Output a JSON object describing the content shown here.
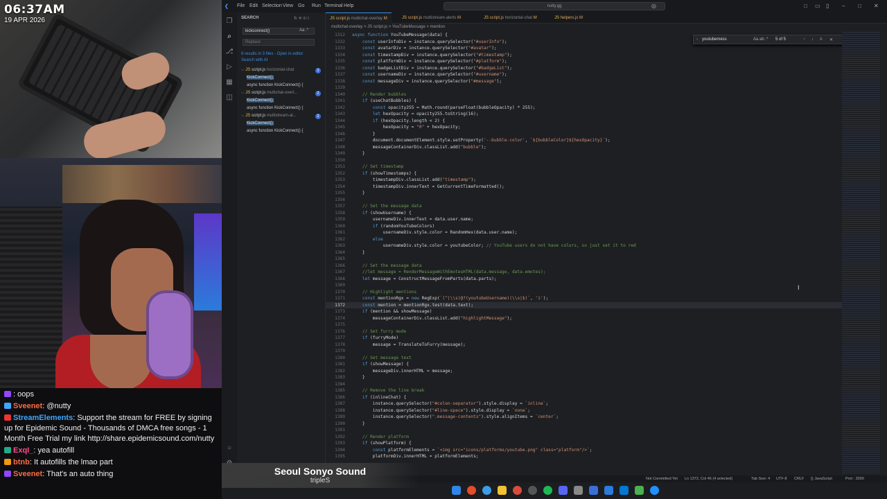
{
  "clock": {
    "time": "06:37AM",
    "date": "19 APR 2026"
  },
  "chat": {
    "messages": [
      {
        "user": "",
        "text": ": oops",
        "color": "#b0b0b0"
      },
      {
        "user": "Sveenet",
        "text": ": @nutty",
        "color": "#ff6a3d"
      },
      {
        "user": "StreamElements",
        "text": ": Support the stream for FREE by signing up for Epidemic Sound - Thousands of DMCA free songs - 1 Month Free Trial my link http://share.epidemicsound.com/nutty",
        "color": "#3ea6ff"
      },
      {
        "user": "ExqI_",
        "text": ": yea autofill",
        "color": "#ff4f8b"
      },
      {
        "user": "btnb",
        "text": ": It autofills the lmao part",
        "color": "#ff6a3d"
      },
      {
        "user": "Sveenet",
        "text": ": That's an auto thing",
        "color": "#ff6a3d"
      }
    ]
  },
  "editor": {
    "menu": [
      "File",
      "Edit",
      "Selection",
      "View",
      "Go",
      "Run",
      "Terminal",
      "Help"
    ],
    "search_box": "nutty.gg",
    "sidebar": {
      "header": "SEARCH",
      "search_value": "kickconnect()",
      "replace_placeholder": "Replace",
      "results_summary": "6 results in 3 files - Open in editor",
      "search_ai": "Search with AI",
      "groups": [
        {
          "file": "script.js",
          "path": "horizontal-chat",
          "count": "2",
          "items": [
            "KickConnect();",
            "async function KickConnect() {"
          ]
        },
        {
          "file": "script.js",
          "path": "multichat-overl...",
          "count": "2",
          "items": [
            "KickConnect();",
            "async function KickConnect() {"
          ]
        },
        {
          "file": "script.js",
          "path": "multistream-al...",
          "count": "2",
          "items": [
            "KickConnect();",
            "async function KickConnect() {"
          ]
        }
      ]
    },
    "tabs": [
      {
        "label": "script.js",
        "sub": "multichat-overlay",
        "flag": "M"
      },
      {
        "label": "script.js",
        "sub": "multistream-alerts",
        "flag": "M"
      },
      {
        "label": "script.js",
        "sub": "horizontal-chat",
        "flag": "M"
      },
      {
        "label": "helpers.js",
        "sub": "",
        "flag": "M"
      }
    ],
    "breadcrumb": "multichat-overlay  >  JS script.js  >  YouTubeMessage  >  mention",
    "find": {
      "value": "youtubemess",
      "count": "5 of 5",
      "options": "Aa  ab  .*"
    },
    "status": {
      "left": "Not Committed Yet",
      "pos": "Ln 1372, Col 46 (4 selected)",
      "tab": "Tab Size: 4",
      "enc": "UTF-8",
      "eol": "CRLF",
      "lang": "{} JavaScript",
      "port": "Port : 3000"
    },
    "code": [
      {
        "n": "1312",
        "t": "async function YouTubeMessage(data) {"
      },
      {
        "n": "1332",
        "t": "    const userInfoDiv = instance.querySelector(\"#userInfo\");"
      },
      {
        "n": "1333",
        "t": "    const avatarDiv = instance.querySelector(\"#avatar\");"
      },
      {
        "n": "1334",
        "t": "    const timestampDiv = instance.querySelector(\"#timestamp\");"
      },
      {
        "n": "1335",
        "t": "    const platformDiv = instance.querySelector(\"#platform\");"
      },
      {
        "n": "1336",
        "t": "    const badgeListDiv = instance.querySelector(\"#badgeList\");"
      },
      {
        "n": "1337",
        "t": "    const usernameDiv = instance.querySelector(\"#username\");"
      },
      {
        "n": "1338",
        "t": "    const messageDiv = instance.querySelector(\"#message\");"
      },
      {
        "n": "1339",
        "t": ""
      },
      {
        "n": "1340",
        "t": "    // Render bubbles"
      },
      {
        "n": "1341",
        "t": "    if (useChatBubbles) {"
      },
      {
        "n": "1342",
        "t": "        const opacity255 = Math.round(parseFloat(bubbleOpacity) * 255);"
      },
      {
        "n": "1343",
        "t": "        let hexOpacity = opacity255.toString(16);"
      },
      {
        "n": "1344",
        "t": "        if (hexOpacity.length < 2) {"
      },
      {
        "n": "1345",
        "t": "            hexOpacity = \"0\" + hexOpacity;"
      },
      {
        "n": "1346",
        "t": "        }"
      },
      {
        "n": "1347",
        "t": "        document.documentElement.style.setProperty('--bubble-color', `${bubbleColor}${hexOpacity}`);"
      },
      {
        "n": "1348",
        "t": "        messageContainerDiv.classList.add(\"bubble\");"
      },
      {
        "n": "1349",
        "t": "    }"
      },
      {
        "n": "1350",
        "t": ""
      },
      {
        "n": "1351",
        "t": "    // Set timestamp"
      },
      {
        "n": "1352",
        "t": "    if (showTimestamps) {"
      },
      {
        "n": "1353",
        "t": "        timestampDiv.classList.add(\"timestamp\");"
      },
      {
        "n": "1354",
        "t": "        timestampDiv.innerText = GetCurrentTimeFormatted();"
      },
      {
        "n": "1355",
        "t": "    }"
      },
      {
        "n": "1356",
        "t": ""
      },
      {
        "n": "1357",
        "t": "    // Set the message data"
      },
      {
        "n": "1358",
        "t": "    if (showUsername) {"
      },
      {
        "n": "1359",
        "t": "        usernameDiv.innerText = data.user.name;"
      },
      {
        "n": "1360",
        "t": "        if (randomYouTubeColors)"
      },
      {
        "n": "1361",
        "t": "            usernameDiv.style.color = RandomHex(data.user.name);"
      },
      {
        "n": "1362",
        "t": "        else"
      },
      {
        "n": "1363",
        "t": "            usernameDiv.style.color = youtubeColor; // YouTube users do not have colors, so just set it to red"
      },
      {
        "n": "1364",
        "t": "    }"
      },
      {
        "n": "1365",
        "t": ""
      },
      {
        "n": "1366",
        "t": "    // Set the message data"
      },
      {
        "n": "1367",
        "t": "    //let message = RenderMessageWithEmotesHTML(data.message, data.emotes);"
      },
      {
        "n": "1368",
        "t": "    let message = ConstructMessageFromParts(data.parts);"
      },
      {
        "n": "1369",
        "t": ""
      },
      {
        "n": "1370",
        "t": "    // Highlight mentions"
      },
      {
        "n": "1371",
        "t": "    const mentionRgx = new RegExp(`(^|\\\\s)@?(youtubeUsername)(\\\\s|$)`, 'i');"
      },
      {
        "n": "1372",
        "t": "    const mention = mentionRgx.test(data.text);"
      },
      {
        "n": "1373",
        "t": "    if (mention && showMessage)"
      },
      {
        "n": "1374",
        "t": "        messageContainerDiv.classList.add(\"highlightMessage\");"
      },
      {
        "n": "1375",
        "t": ""
      },
      {
        "n": "1376",
        "t": "    // Set furry mode"
      },
      {
        "n": "1377",
        "t": "    if (furryMode)"
      },
      {
        "n": "1378",
        "t": "        message = TranslateToFurry(message);"
      },
      {
        "n": "1379",
        "t": ""
      },
      {
        "n": "1380",
        "t": "    // Set message text"
      },
      {
        "n": "1381",
        "t": "    if (showMessage) {"
      },
      {
        "n": "1382",
        "t": "        messageDiv.innerHTML = message;"
      },
      {
        "n": "1383",
        "t": "    }"
      },
      {
        "n": "1384",
        "t": ""
      },
      {
        "n": "1385",
        "t": "    // Remove the line break"
      },
      {
        "n": "1386",
        "t": "    if (inlineChat) {"
      },
      {
        "n": "1387",
        "t": "        instance.querySelector(\"#colon-separator\").style.display = `inline`;"
      },
      {
        "n": "1388",
        "t": "        instance.querySelector(\"#line-space\").style.display = `none`;"
      },
      {
        "n": "1389",
        "t": "        instance.querySelector(\".message-contents\").style.alignItems = `center`;"
      },
      {
        "n": "1390",
        "t": "    }"
      },
      {
        "n": "1391",
        "t": ""
      },
      {
        "n": "1392",
        "t": "    // Render platform"
      },
      {
        "n": "1393",
        "t": "    if (showPlatform) {"
      },
      {
        "n": "1394",
        "t": "        const platformElements = `<img src=\"icons/platforms/youtube.png\" class=\"platform\"/>`;"
      },
      {
        "n": "1395",
        "t": "        platformDiv.innerHTML = platformElements;"
      }
    ]
  },
  "music": {
    "title": "Seoul Sonyo Sound",
    "artist": "tripleS"
  }
}
